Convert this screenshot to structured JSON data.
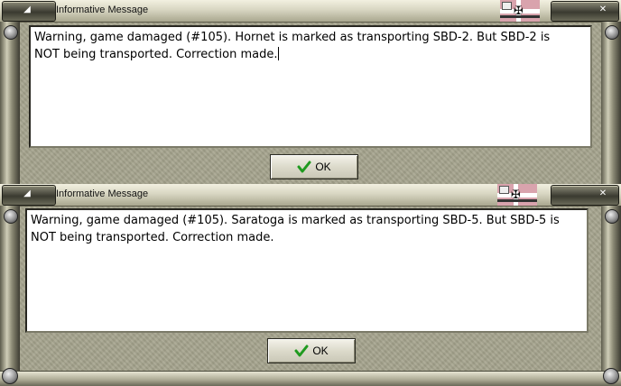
{
  "dialogs": [
    {
      "title": "Informative Message",
      "message_line1": "Warning, game damaged (#105).  Hornet is marked as transporting SBD-2.  But SBD-2 is",
      "message_line2": "NOT being transported.  Correction made.",
      "ok_label": "OK"
    },
    {
      "title": "Informative Message",
      "message_line1": "Warning, game damaged (#105).  Saratoga is marked as transporting SBD-5.  But SBD-5 is",
      "message_line2": "NOT being transported.  Correction made.",
      "ok_label": "OK"
    }
  ],
  "icons": {
    "minimize": "minimize-icon",
    "close": "close-icon",
    "flag": "iron-cross-flag-icon",
    "ok": "checkmark-icon"
  },
  "colors": {
    "frame": "#a7a58f",
    "message_bg": "#ffffff",
    "check": "#1f9a1f",
    "flag_bg": "#d9a3ad"
  }
}
